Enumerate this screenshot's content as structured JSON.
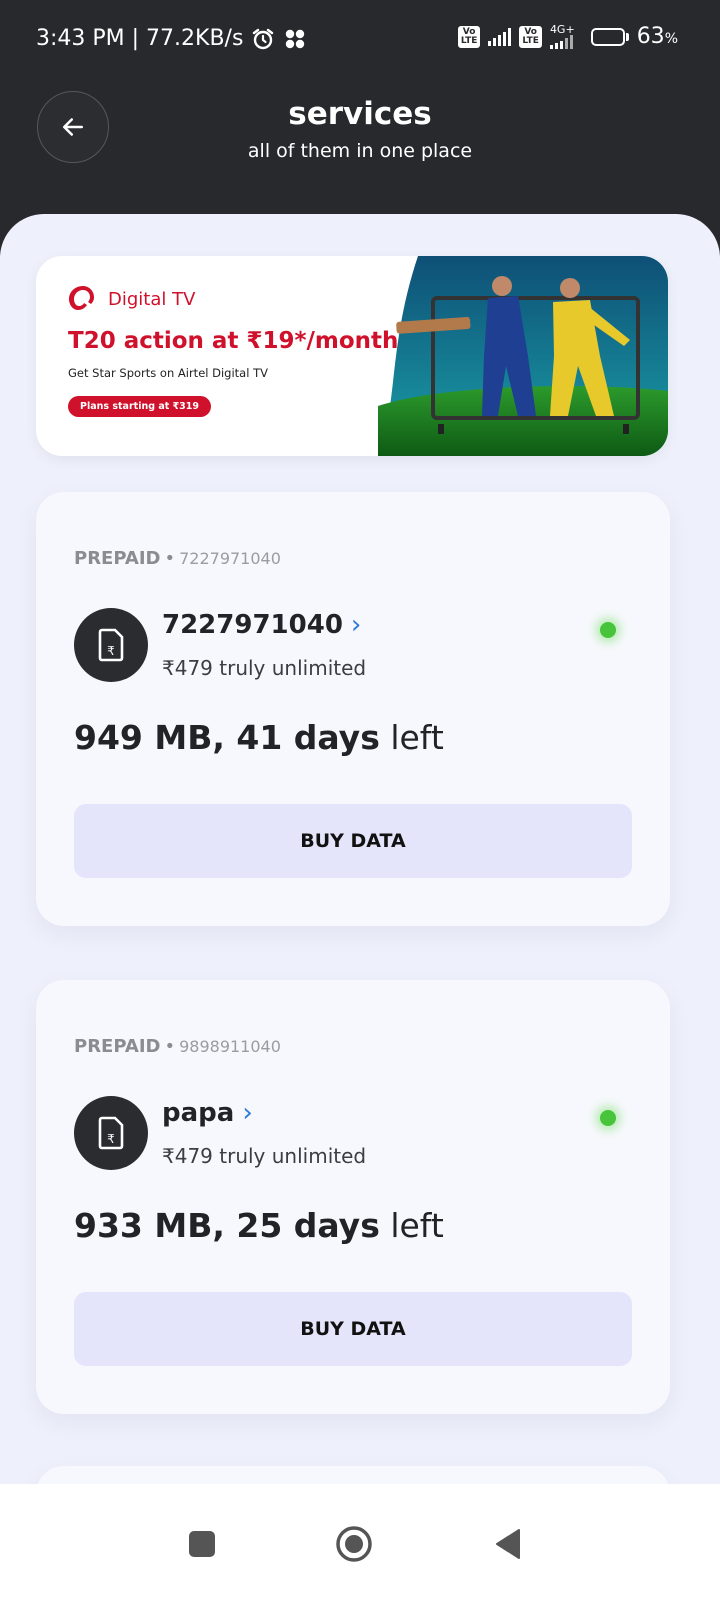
{
  "status_bar": {
    "time_speed": "3:43 PM | 77.2KB/s",
    "lte_label_1": "Vo\nLTE",
    "lte_label_2": "Vo\nLTE",
    "network_type": "4G+",
    "battery_percent": "63",
    "battery_percent_sign": "%",
    "battery_level": 0.63
  },
  "header": {
    "title": "services",
    "subtitle": "all of them in one place"
  },
  "banner": {
    "brand": "Digital TV",
    "title": "T20 action at ₹19*/month",
    "subtitle": "Get Star Sports on Airtel Digital TV",
    "pill": "Plans starting at ₹319",
    "accent_color": "#d0112b"
  },
  "accounts": [
    {
      "type": "PREPAID",
      "separator": "•",
      "number": "7227971040",
      "name": "7227971040",
      "plan": "₹479 truly unlimited",
      "usage_bold": "949 MB, 41 days",
      "usage_rest": " left",
      "status_color": "#47c43b",
      "button": "BUY DATA"
    },
    {
      "type": "PREPAID",
      "separator": "•",
      "number": "9898911040",
      "name": "papa",
      "plan": "₹479 truly unlimited",
      "usage_bold": "933 MB, 25 days",
      "usage_rest": " left",
      "status_color": "#47c43b",
      "button": "BUY DATA"
    }
  ],
  "chevron": "›",
  "nav": {
    "recent_icon": "square-icon",
    "home_icon": "circle-icon",
    "back_icon": "triangle-back-icon"
  }
}
